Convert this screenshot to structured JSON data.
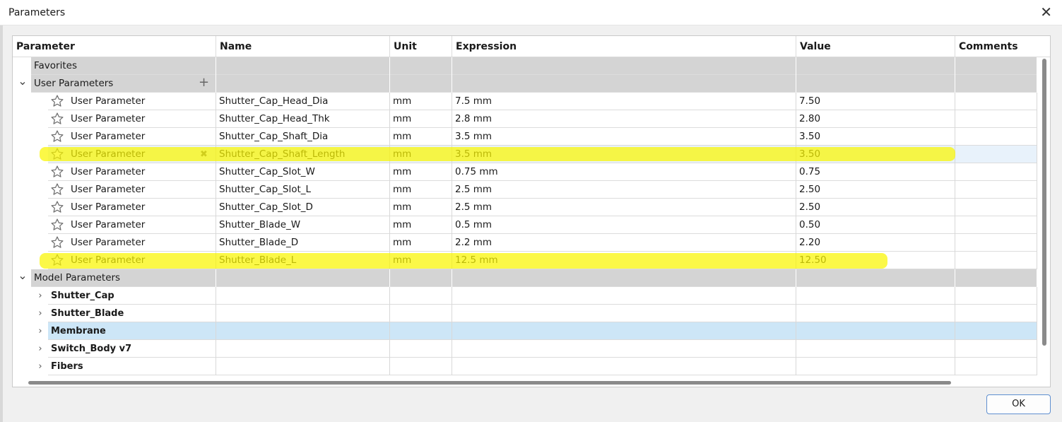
{
  "window": {
    "title": "Parameters",
    "close_glyph": "✕",
    "icon": "close-icon"
  },
  "columns": [
    "Parameter",
    "Name",
    "Unit",
    "Expression",
    "Value",
    "Comments"
  ],
  "groups": {
    "favorites": {
      "label": "Favorites"
    },
    "user_parameters": {
      "label": "User Parameters",
      "expanded": true,
      "add_glyph": "+"
    },
    "model_parameters": {
      "label": "Model Parameters",
      "expanded": true
    }
  },
  "user_params": [
    {
      "type": "User Parameter",
      "name": "Shutter_Cap_Head_Dia",
      "unit": "mm",
      "expression": "7.5 mm",
      "value": "7.50",
      "comments": ""
    },
    {
      "type": "User Parameter",
      "name": "Shutter_Cap_Head_Thk",
      "unit": "mm",
      "expression": "2.8 mm",
      "value": "2.80",
      "comments": ""
    },
    {
      "type": "User Parameter",
      "name": "Shutter_Cap_Shaft_Dia",
      "unit": "mm",
      "expression": "3.5 mm",
      "value": "3.50",
      "comments": ""
    },
    {
      "type": "User Parameter",
      "name": "Shutter_Cap_Shaft_Length",
      "unit": "mm",
      "expression": "3.5 mm",
      "value": "3.50",
      "comments": "",
      "hovered": true,
      "delete_glyph": "✖"
    },
    {
      "type": "User Parameter",
      "name": "Shutter_Cap_Slot_W",
      "unit": "mm",
      "expression": "0.75 mm",
      "value": "0.75",
      "comments": ""
    },
    {
      "type": "User Parameter",
      "name": "Shutter_Cap_Slot_L",
      "unit": "mm",
      "expression": "2.5 mm",
      "value": "2.50",
      "comments": ""
    },
    {
      "type": "User Parameter",
      "name": "Shutter_Cap_Slot_D",
      "unit": "mm",
      "expression": "2.5 mm",
      "value": "2.50",
      "comments": ""
    },
    {
      "type": "User Parameter",
      "name": "Shutter_Blade_W",
      "unit": "mm",
      "expression": "0.5 mm",
      "value": "0.50",
      "comments": ""
    },
    {
      "type": "User Parameter",
      "name": "Shutter_Blade_D",
      "unit": "mm",
      "expression": "2.2 mm",
      "value": "2.20",
      "comments": ""
    },
    {
      "type": "User Parameter",
      "name": "Shutter_Blade_L",
      "unit": "mm",
      "expression": "12.5 mm",
      "value": "12.50",
      "comments": ""
    }
  ],
  "model_params": [
    {
      "label": "Shutter_Cap",
      "expanded": false,
      "selected": false
    },
    {
      "label": "Shutter_Blade",
      "expanded": false,
      "selected": false
    },
    {
      "label": "Membrane",
      "expanded": false,
      "selected": true
    },
    {
      "label": "Switch_Body v7",
      "expanded": false,
      "selected": false
    },
    {
      "label": "Fibers",
      "expanded": false,
      "selected": false
    }
  ],
  "highlights": {
    "color": "#faf500",
    "rows": [
      "Shutter_Cap_Shaft_Length",
      "Shutter_Blade_L"
    ]
  },
  "icons": {
    "favorite": "star-outline-icon",
    "expand": "chevron-right-icon",
    "collapse": "chevron-down-icon"
  },
  "footer": {
    "ok_label": "OK"
  }
}
